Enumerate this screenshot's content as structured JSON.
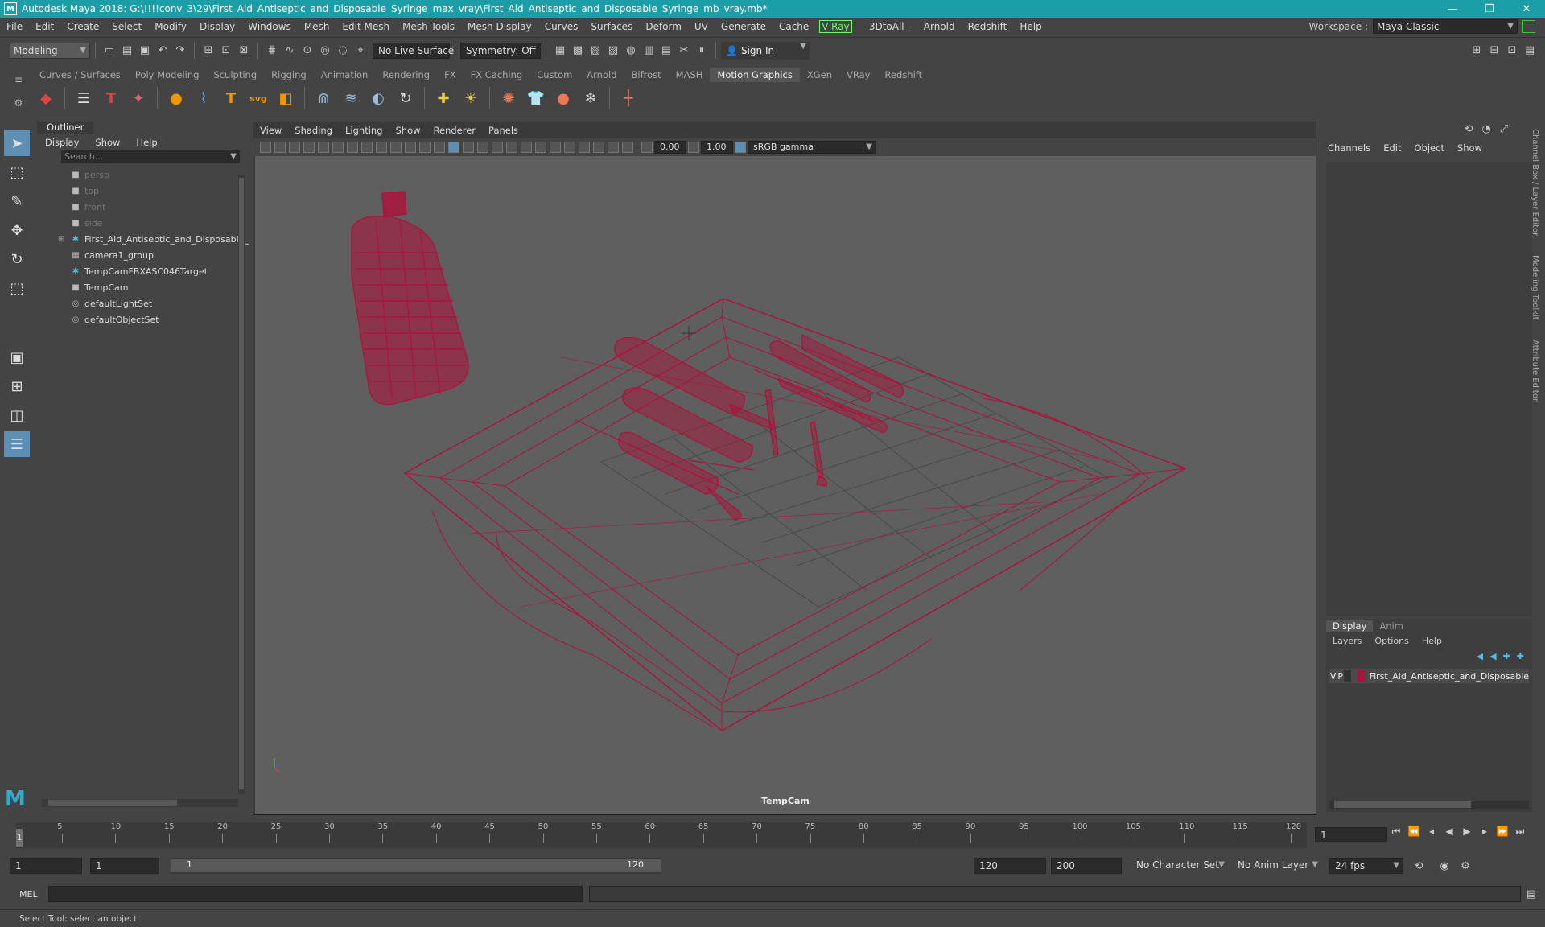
{
  "window": {
    "title": "Autodesk Maya 2018: G:\\!!!!conv_3\\29\\First_Aid_Antiseptic_and_Disposable_Syringe_max_vray\\First_Aid_Antiseptic_and_Disposable_Syringe_mb_vray.mb*",
    "logo": "M",
    "min": "—",
    "max": "❐",
    "close": "✕"
  },
  "menubar": {
    "items": [
      "File",
      "Edit",
      "Create",
      "Select",
      "Modify",
      "Display",
      "Windows",
      "Mesh",
      "Edit Mesh",
      "Mesh Tools",
      "Mesh Display",
      "Curves",
      "Surfaces",
      "Deform",
      "UV",
      "Generate",
      "Cache"
    ],
    "vray": "V-Ray",
    "items2": [
      "- 3DtoAll -",
      "Arnold",
      "Redshift",
      "Help"
    ],
    "workspace_label": "Workspace :",
    "workspace_value": "Maya Classic"
  },
  "statusline": {
    "mode": "Modeling",
    "live_surface": "No Live Surface",
    "symmetry": "Symmetry: Off",
    "sign_in": "Sign In"
  },
  "shelf": {
    "tabs": [
      "Curves / Surfaces",
      "Poly Modeling",
      "Sculpting",
      "Rigging",
      "Animation",
      "Rendering",
      "FX",
      "FX Caching",
      "Custom",
      "Arnold",
      "Bifrost",
      "MASH",
      "Motion Graphics",
      "XGen",
      "VRay",
      "Redshift"
    ],
    "active_tab": "Motion Graphics"
  },
  "outliner": {
    "title": "Outliner",
    "menu": [
      "Display",
      "Show",
      "Help"
    ],
    "search_placeholder": "Search...",
    "items": [
      {
        "label": "persp",
        "icon": "camera-icon",
        "dim": true
      },
      {
        "label": "top",
        "icon": "camera-icon",
        "dim": true
      },
      {
        "label": "front",
        "icon": "camera-icon",
        "dim": true
      },
      {
        "label": "side",
        "icon": "camera-icon",
        "dim": true
      },
      {
        "label": "First_Aid_Antiseptic_and_Disposable_",
        "icon": "group-icon",
        "dim": false
      },
      {
        "label": "camera1_group",
        "icon": "group-node-icon",
        "dim": false
      },
      {
        "label": "TempCamFBXASC046Target",
        "icon": "locator-icon",
        "dim": false
      },
      {
        "label": "TempCam",
        "icon": "camera-icon",
        "dim": false
      },
      {
        "label": "defaultLightSet",
        "icon": "set-icon",
        "dim": false
      },
      {
        "label": "defaultObjectSet",
        "icon": "set-icon",
        "dim": false
      }
    ]
  },
  "viewport": {
    "menu": [
      "View",
      "Shading",
      "Lighting",
      "Show",
      "Renderer",
      "Panels"
    ],
    "exposure": "0.00",
    "gamma": "1.00",
    "color_space": "sRGB gamma",
    "camera_label": "TempCam",
    "wire_color": "#b0103a"
  },
  "right_panel": {
    "tabs": [
      "Channels",
      "Edit",
      "Object",
      "Show"
    ],
    "layer_tabs": [
      "Display",
      "Anim"
    ],
    "layer_menu": [
      "Layers",
      "Options",
      "Help"
    ],
    "layer": {
      "v": "V",
      "p": "P",
      "name": "First_Aid_Antiseptic_and_Disposable",
      "color": "#b0103a"
    },
    "side_tabs": [
      "Channel Box / Layer Editor",
      "Modeling Toolkit",
      "Attribute Editor"
    ]
  },
  "timeline": {
    "ticks": [
      "5",
      "10",
      "15",
      "20",
      "25",
      "30",
      "35",
      "40",
      "45",
      "50",
      "55",
      "60",
      "65",
      "70",
      "75",
      "80",
      "85",
      "90",
      "95",
      "100",
      "105",
      "110",
      "115",
      "120"
    ],
    "current_marker": "1",
    "current_frame": "1"
  },
  "range": {
    "start": "1",
    "anim_start": "1",
    "range_start": "1",
    "range_end": "120",
    "anim_end": "120",
    "end": "200",
    "char_set": "No Character Set",
    "anim_layer": "No Anim Layer",
    "fps": "24 fps"
  },
  "cmdline": {
    "lang": "MEL"
  },
  "helpline": {
    "text": "Select Tool: select an object"
  }
}
